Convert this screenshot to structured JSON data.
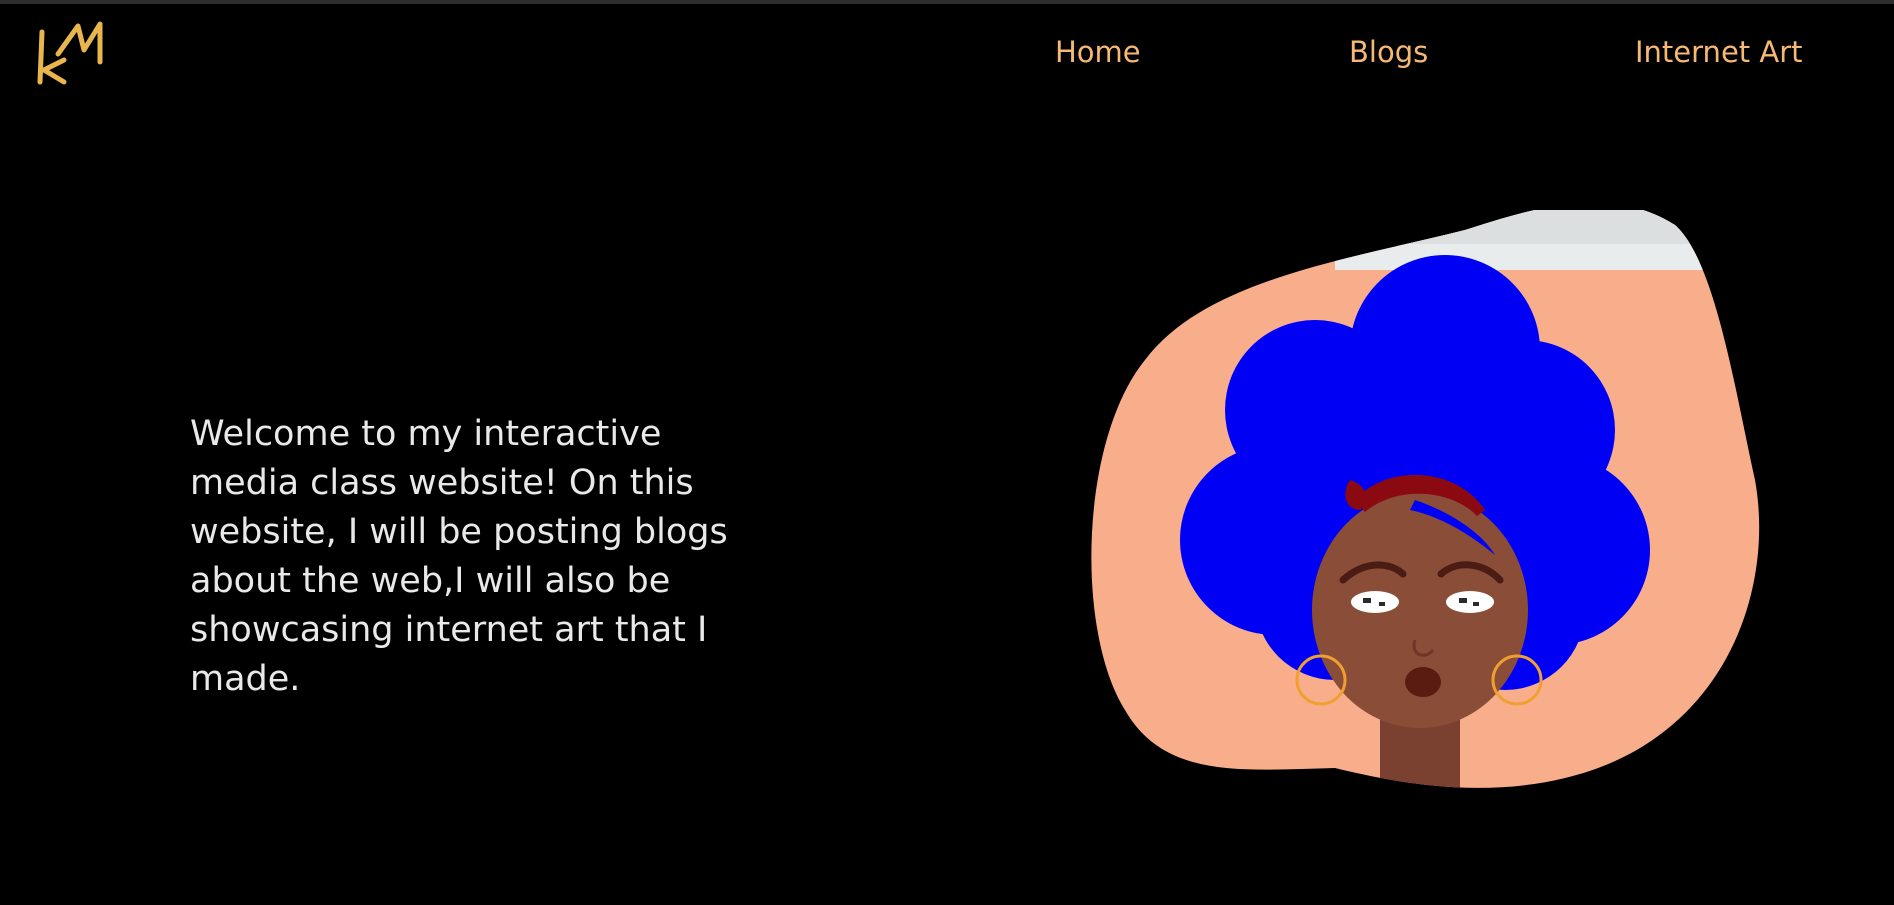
{
  "header": {
    "logo_icon": "km-monogram-logo",
    "accent_color": "#f7b876"
  },
  "nav": {
    "items": [
      {
        "label": "Home"
      },
      {
        "label": "Blogs"
      },
      {
        "label": "Internet Art"
      }
    ]
  },
  "main": {
    "intro_text": "Welcome to my interactive media class website! On this website, I will be posting blogs about the web,I will also be showcasing internet art that I made.",
    "hero_image": {
      "description_icon": "cartoon-woman-blue-afro-illustration",
      "colors": {
        "background": "#f8ae8a",
        "hair": "#0000f5",
        "skin": "#8a4d38",
        "headband": "#8b0a12",
        "earrings": "#f0a030"
      }
    }
  }
}
